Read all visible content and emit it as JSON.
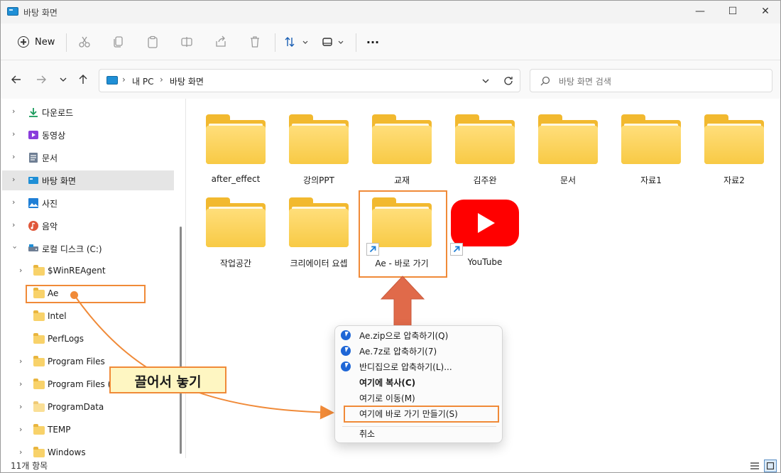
{
  "window": {
    "title": "바탕 화면",
    "minimize": "—",
    "maximize": "☐",
    "close": "✕"
  },
  "toolbar": {
    "new_label": "New",
    "more_label": "···"
  },
  "address": {
    "crumbs": [
      "내 PC",
      "바탕 화면"
    ],
    "search_placeholder": "바탕 화면 검색"
  },
  "sidebar": {
    "items": [
      {
        "label": "다운로드",
        "icon": "download-icon"
      },
      {
        "label": "동영상",
        "icon": "video-icon"
      },
      {
        "label": "문서",
        "icon": "document-icon"
      },
      {
        "label": "바탕 화면",
        "icon": "desktop-icon"
      },
      {
        "label": "사진",
        "icon": "picture-icon"
      },
      {
        "label": "음악",
        "icon": "music-icon"
      },
      {
        "label": "로컬 디스크 (C:)",
        "icon": "drive-icon"
      }
    ],
    "children": [
      {
        "label": "$WinREAgent"
      },
      {
        "label": "Ae"
      },
      {
        "label": "Intel"
      },
      {
        "label": "PerfLogs"
      },
      {
        "label": "Program Files"
      },
      {
        "label": "Program Files (x"
      },
      {
        "label": "ProgramData"
      },
      {
        "label": "TEMP"
      },
      {
        "label": "Windows"
      }
    ]
  },
  "content": {
    "folders": [
      {
        "label": "after_effect"
      },
      {
        "label": "강의PPT"
      },
      {
        "label": "교재"
      },
      {
        "label": "김주완"
      },
      {
        "label": "문서"
      },
      {
        "label": "자료1"
      },
      {
        "label": "자료2"
      },
      {
        "label": "작업공간"
      },
      {
        "label": "크리에이터 요셉"
      },
      {
        "label": "Ae - 바로 가기"
      },
      {
        "label": "YouTube"
      }
    ]
  },
  "context_menu": {
    "items": [
      {
        "label": "Ae.zip으로 압축하기(Q)"
      },
      {
        "label": "Ae.7z로 압축하기(7)"
      },
      {
        "label": "반디집으로 압축하기(L)..."
      },
      {
        "label": "여기에 복사(C)"
      },
      {
        "label": "여기로 이동(M)"
      },
      {
        "label": "여기에 바로 가기 만들기(S)"
      },
      {
        "label": "취소"
      }
    ]
  },
  "annotation": {
    "callout": "끌어서 놓기"
  },
  "status": {
    "count": "11개 항목"
  },
  "colors": {
    "accent_orange": "#f08a38",
    "folder_yellow": "#f8ca45",
    "youtube_red": "#ff0000",
    "selection_gray": "#e5e5e5"
  }
}
